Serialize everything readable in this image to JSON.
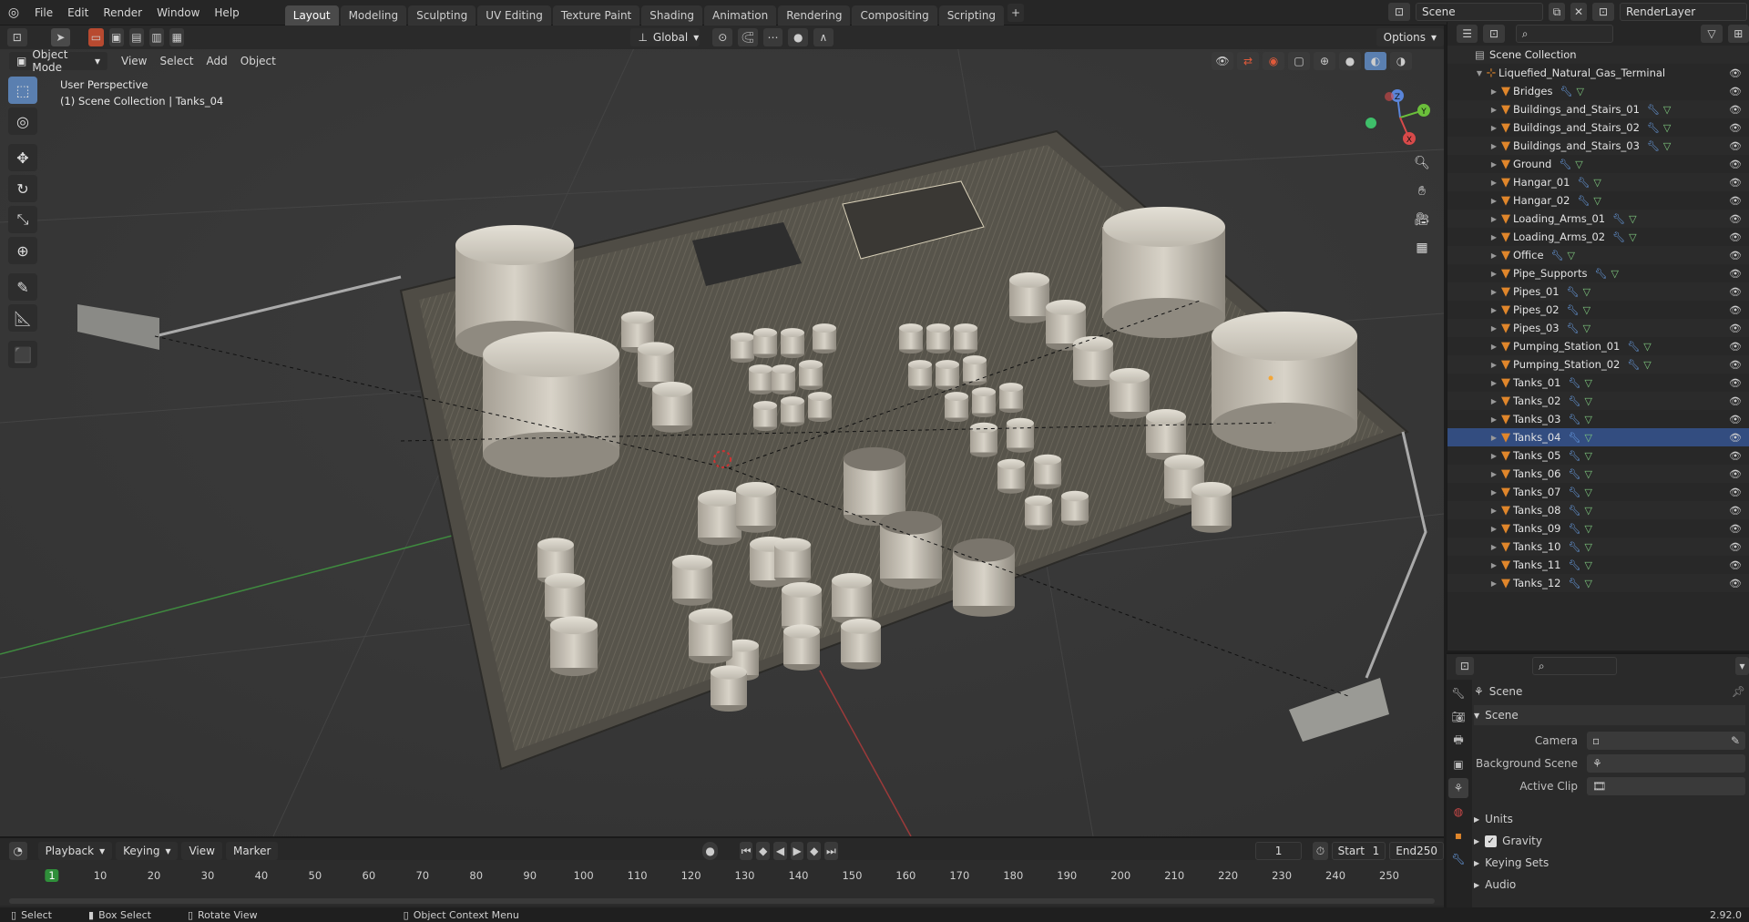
{
  "topbar": {
    "menus": [
      "File",
      "Edit",
      "Render",
      "Window",
      "Help"
    ],
    "workspaces": [
      "Layout",
      "Modeling",
      "Sculpting",
      "UV Editing",
      "Texture Paint",
      "Shading",
      "Animation",
      "Rendering",
      "Compositing",
      "Scripting"
    ],
    "active_workspace": "Layout",
    "add_tab": "+",
    "scene_name": "Scene",
    "render_layer": "RenderLayer"
  },
  "viewport": {
    "mode": "Object Mode",
    "menus": [
      "View",
      "Select",
      "Add",
      "Object"
    ],
    "transform_orientation": "Global",
    "options_label": "Options",
    "overlay_title": "User Perspective",
    "overlay_subtitle": "(1) Scene Collection | Tanks_04",
    "gizmo": {
      "z": "Z",
      "y": "Y",
      "x": "X"
    }
  },
  "outliner": {
    "root": "Scene Collection",
    "collection": "Liquefied_Natural_Gas_Terminal",
    "selected": "Tanks_04",
    "items": [
      "Bridges",
      "Buildings_and_Stairs_01",
      "Buildings_and_Stairs_02",
      "Buildings_and_Stairs_03",
      "Ground",
      "Hangar_01",
      "Hangar_02",
      "Loading_Arms_01",
      "Loading_Arms_02",
      "Office",
      "Pipe_Supports",
      "Pipes_01",
      "Pipes_02",
      "Pipes_03",
      "Pumping_Station_01",
      "Pumping_Station_02",
      "Tanks_01",
      "Tanks_02",
      "Tanks_03",
      "Tanks_04",
      "Tanks_05",
      "Tanks_06",
      "Tanks_07",
      "Tanks_08",
      "Tanks_09",
      "Tanks_10",
      "Tanks_11",
      "Tanks_12"
    ]
  },
  "properties": {
    "context": "Scene",
    "panel": "Scene",
    "camera_label": "Camera",
    "background_label": "Background Scene",
    "clip_label": "Active Clip",
    "units": "Units",
    "gravity": "Gravity",
    "gravity_checked": true,
    "keying_sets": "Keying Sets",
    "audio": "Audio"
  },
  "timeline": {
    "menus": [
      "Playback",
      "Keying",
      "View",
      "Marker"
    ],
    "current_frame": "1",
    "start_label": "Start",
    "start": "1",
    "end_label": "End",
    "end": "250",
    "ticks": [
      "1",
      "10",
      "20",
      "30",
      "40",
      "50",
      "60",
      "70",
      "80",
      "90",
      "100",
      "110",
      "120",
      "130",
      "140",
      "150",
      "160",
      "170",
      "180",
      "190",
      "200",
      "210",
      "220",
      "230",
      "240",
      "250"
    ]
  },
  "statusbar": {
    "select": "Select",
    "box_select": "Box Select",
    "rotate_view": "Rotate View",
    "context_menu": "Object Context Menu",
    "version": "2.92.0"
  },
  "colors": {
    "accent": "#4772b3",
    "object_orange": "#e0862b",
    "current_frame": "#2f8f3a"
  }
}
